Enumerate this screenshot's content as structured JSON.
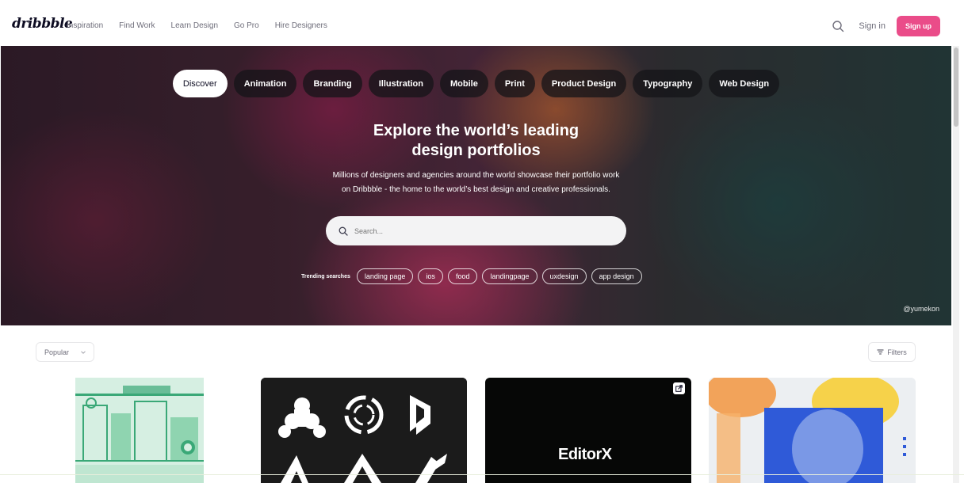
{
  "nav": {
    "logo": "dribbble",
    "links": [
      "Inspiration",
      "Find Work",
      "Learn Design",
      "Go Pro",
      "Hire Designers"
    ],
    "sign_in": "Sign in",
    "sign_up": "Sign up"
  },
  "hero": {
    "categories": [
      "Discover",
      "Animation",
      "Branding",
      "Illustration",
      "Mobile",
      "Print",
      "Product Design",
      "Typography",
      "Web Design"
    ],
    "active_category": "Discover",
    "title_line1": "Explore the world’s leading",
    "title_line2": "design portfolios",
    "subtitle_line1": "Millions of designers and agencies around the world showcase their portfolio work",
    "subtitle_line2": "on Dribbble - the home to the world’s best design and creative professionals.",
    "search_placeholder": "Search...",
    "trending_label": "Trending searches",
    "trending_tags": [
      "landing page",
      "ios",
      "food",
      "landingpage",
      "uxdesign",
      "app design"
    ],
    "credit": "@yumekon"
  },
  "feed": {
    "sort": "Popular",
    "filters": "Filters",
    "card3_text": "EditorX"
  },
  "colors": {
    "brand": "#ea4c89",
    "text": "#0d0c22",
    "muted": "#6e6d7a"
  }
}
